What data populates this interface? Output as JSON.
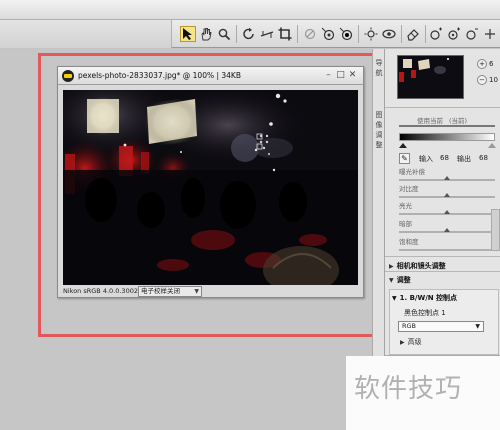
{
  "toolbar": {
    "tools": [
      "direct-select-icon",
      "hand-icon",
      "zoom-icon",
      "rotate-icon",
      "straighten-icon",
      "crop-icon",
      "red-eye-icon",
      "color-point-icon",
      "black-point-icon",
      "white-point-icon",
      "brightness-icon",
      "preview-icon",
      "eraser-icon",
      "before-after-icon",
      "plus-icon"
    ]
  },
  "document": {
    "title": "pexels-photo-2833037.jpg* @ 100% | 34KB",
    "color_profile": "Nikon sRGB 4.0.0.3002",
    "softproof_dropdown": "电子校样关闭"
  },
  "navigator": {
    "values": [
      "6",
      "10"
    ]
  },
  "side_tabs": [
    "导",
    "航",
    "图",
    "像",
    "调",
    "整"
  ],
  "adjustments": {
    "levels_labels": [
      "使用当前",
      "(当前)"
    ],
    "input_label": "输入",
    "input_value": "68",
    "output_label": "输出",
    "output_value": "68",
    "sliders": [
      "曝光补偿",
      "对比度",
      "亮光",
      "暗部",
      "饱和度"
    ],
    "camera_lens_section": "相机和镜头调整",
    "adjust_section": "调整",
    "control_point_section": "1. B/W/N 控制点",
    "control_point_name": "黑色控制点 1",
    "channel_select": "RGB",
    "advanced": "高级"
  },
  "watermark": "软件技巧",
  "colors": {
    "callout_border": "#e4575a",
    "active_tool": "#f6e38a"
  }
}
